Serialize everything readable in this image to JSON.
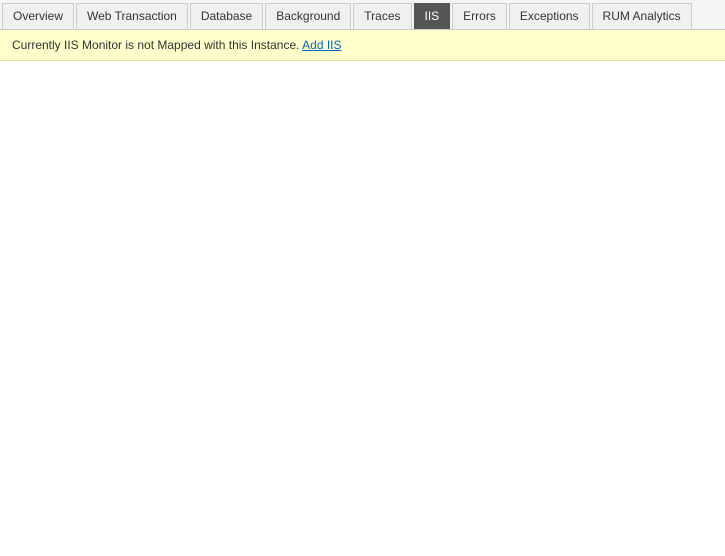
{
  "tabs": [
    {
      "id": "overview",
      "label": "Overview",
      "active": false
    },
    {
      "id": "web-transaction",
      "label": "Web Transaction",
      "active": false
    },
    {
      "id": "database",
      "label": "Database",
      "active": false
    },
    {
      "id": "background",
      "label": "Background",
      "active": false
    },
    {
      "id": "traces",
      "label": "Traces",
      "active": false
    },
    {
      "id": "iis",
      "label": "IIS",
      "active": true
    },
    {
      "id": "errors",
      "label": "Errors",
      "active": false
    },
    {
      "id": "exceptions",
      "label": "Exceptions",
      "active": false
    },
    {
      "id": "rum-analytics",
      "label": "RUM Analytics",
      "active": false
    }
  ],
  "notification": {
    "message": "Currently IIS Monitor is not Mapped with this Instance.",
    "link_text": "Add IIS"
  }
}
